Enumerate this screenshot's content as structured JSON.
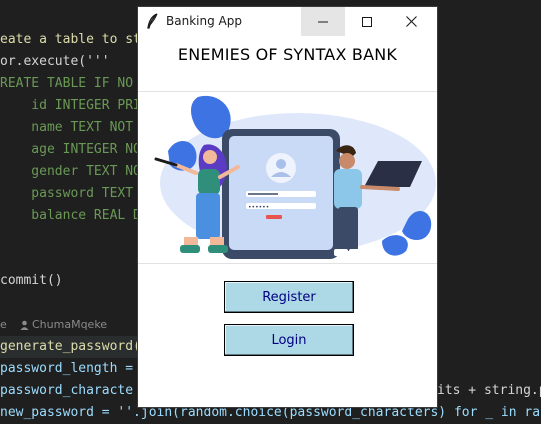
{
  "editor": {
    "lines": [
      "eate a table to st",
      "or.execute('''",
      "REATE TABLE IF NO",
      "    id INTEGER PRI",
      "    name TEXT NOT ",
      "    age INTEGER NO",
      "    gender TEXT NO",
      "    password TEXT ",
      "    balance REAL D",
      "",
      "",
      "commit()",
      "",
      "",
      "generate_password(",
      "password_length = ",
      "password_characte",
      "new_password = ''.join(random.choice(password_characters) for _ in ra"
    ],
    "blame": {
      "left": "e",
      "author_icon": "person-icon",
      "author": "ChumaMqeke"
    },
    "right_fragment": "its + string.p"
  },
  "window": {
    "title": "Banking App",
    "app_icon": "feather-icon",
    "controls": {
      "minimize_icon": "minimize-icon",
      "maximize_icon": "maximize-icon",
      "close_icon": "close-icon"
    }
  },
  "app": {
    "bank_name": "ENEMIES OF SYNTAX BANK",
    "illustration": "login-illustration",
    "register_label": "Register",
    "login_label": "Login"
  },
  "colors": {
    "button_bg": "#add8e6",
    "button_text": "#000080",
    "editor_bg": "#1f1f1f",
    "illustration_blue": "#3d73e3"
  }
}
